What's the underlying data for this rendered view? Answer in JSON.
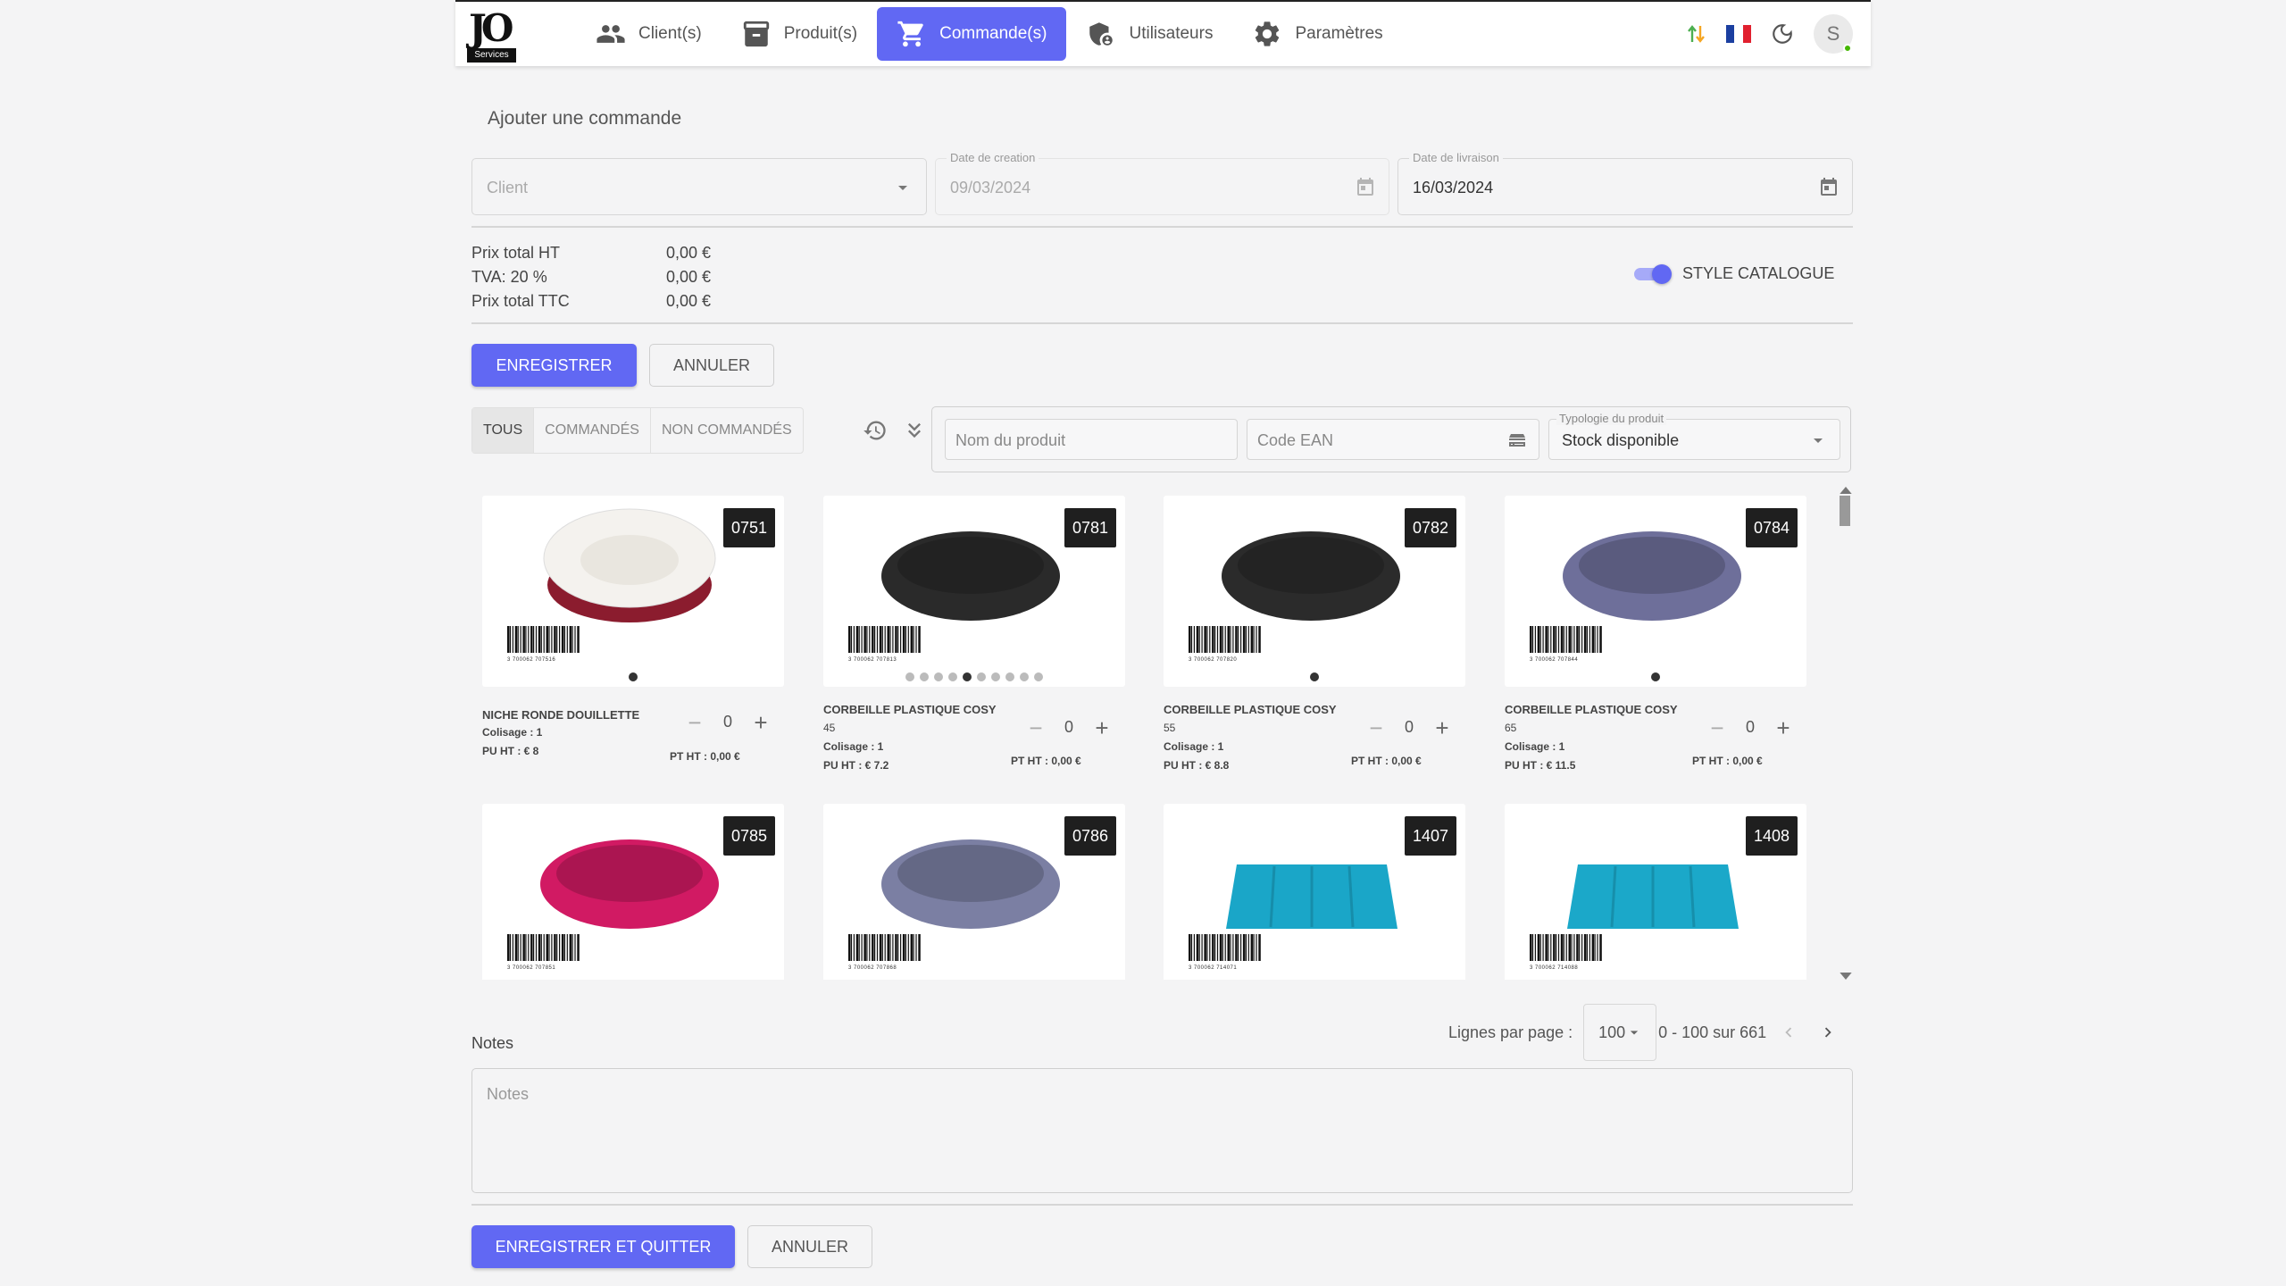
{
  "brand": {
    "logo_text": "JO",
    "logo_sub": "Services"
  },
  "nav": {
    "items": [
      {
        "label": "Client(s)",
        "icon": "people-icon"
      },
      {
        "label": "Produit(s)",
        "icon": "archive-icon"
      },
      {
        "label": "Commande(s)",
        "icon": "cart-icon",
        "active": true
      },
      {
        "label": "Utilisateurs",
        "icon": "shield-user-icon"
      },
      {
        "label": "Paramètres",
        "icon": "gear-icon"
      }
    ],
    "avatar_initial": "S"
  },
  "form": {
    "title": "Ajouter une commande",
    "client": {
      "placeholder": "Client"
    },
    "date_creation": {
      "label": "Date de creation",
      "value": "09/03/2024"
    },
    "date_livraison": {
      "label": "Date de livraison",
      "value": "16/03/2024"
    }
  },
  "totals": [
    {
      "label": "Prix total HT",
      "value": "0,00 €"
    },
    {
      "label": "TVA: 20 %",
      "value": "0,00 €"
    },
    {
      "label": "Prix total TTC",
      "value": "0,00 €"
    }
  ],
  "catalogue_toggle": {
    "label": "STYLE CATALOGUE",
    "on": true
  },
  "actions": {
    "save": "Enregistrer",
    "cancel": "Annuler",
    "save_quit": "Enregistrer et quitter",
    "cancel_bottom": "Annuler"
  },
  "filters": {
    "segments": [
      "TOUS",
      "COMMANDÉS",
      "NON COMMANDÉS"
    ],
    "product_name_placeholder": "Nom du produit",
    "ean_placeholder": "Code EAN",
    "typology_label": "Typologie du produit",
    "typology_value": "Stock disponible"
  },
  "products": [
    {
      "ref": "0751",
      "name": "NICHE RONDE DOUILLETTE",
      "size": "",
      "colisage": "Colisage : 1",
      "pu": "PU HT : € 8",
      "qty": "0",
      "pt": "PT HT : 0,00 €",
      "color": "#8b1c2e",
      "dots": 1,
      "active_dot": 0,
      "barcode": "3 700062 707516"
    },
    {
      "ref": "0781",
      "name": "CORBEILLE PLASTIQUE COSY",
      "size": "45",
      "colisage": "Colisage : 1",
      "pu": "PU HT : € 7.2",
      "qty": "0",
      "pt": "PT HT : 0,00 €",
      "color": "#2a2a2a",
      "dots": 10,
      "active_dot": 4,
      "barcode": "3 700062 707813"
    },
    {
      "ref": "0782",
      "name": "CORBEILLE PLASTIQUE COSY",
      "size": "55",
      "colisage": "Colisage : 1",
      "pu": "PU HT : € 8.8",
      "qty": "0",
      "pt": "PT HT : 0,00 €",
      "color": "#2b2b2b",
      "dots": 1,
      "active_dot": 0,
      "barcode": "3 700062 707820"
    },
    {
      "ref": "0784",
      "name": "CORBEILLE PLASTIQUE COSY",
      "size": "65",
      "colisage": "Colisage : 1",
      "pu": "PU HT : € 11.5",
      "qty": "0",
      "pt": "PT HT : 0,00 €",
      "color": "#6e6f9a",
      "dots": 1,
      "active_dot": 0,
      "barcode": "3 700062 707844"
    },
    {
      "ref": "0785",
      "name": "",
      "size": "",
      "colisage": "",
      "pu": "",
      "qty": "",
      "pt": "",
      "color": "#d11a63",
      "dots": 1,
      "active_dot": 0,
      "barcode": "3 700062 707851"
    },
    {
      "ref": "0786",
      "name": "",
      "size": "",
      "colisage": "",
      "pu": "",
      "qty": "",
      "pt": "",
      "color": "#7b7fa3",
      "dots": 1,
      "active_dot": 0,
      "barcode": "3 700062 707868"
    },
    {
      "ref": "1407",
      "name": "",
      "size": "",
      "colisage": "",
      "pu": "",
      "qty": "",
      "pt": "",
      "color": "#1aa6c8",
      "dots": 1,
      "active_dot": 0,
      "barcode": "3 700062 714071"
    },
    {
      "ref": "1408",
      "name": "",
      "size": "",
      "colisage": "",
      "pu": "",
      "qty": "",
      "pt": "",
      "color": "#1ba8c9",
      "dots": 1,
      "active_dot": 0,
      "barcode": "3 700062 714088"
    }
  ],
  "pagination": {
    "label": "Lignes par page :",
    "per_page": "100",
    "range": "0 - 100 sur 661"
  },
  "notes": {
    "label": "Notes",
    "placeholder": "Notes"
  },
  "colors": {
    "primary": "#6168f3",
    "flag_blue": "#1b3fa0",
    "flag_red": "#e1202f",
    "sync_green": "#4caf50",
    "sync_orange": "#f5a623"
  }
}
